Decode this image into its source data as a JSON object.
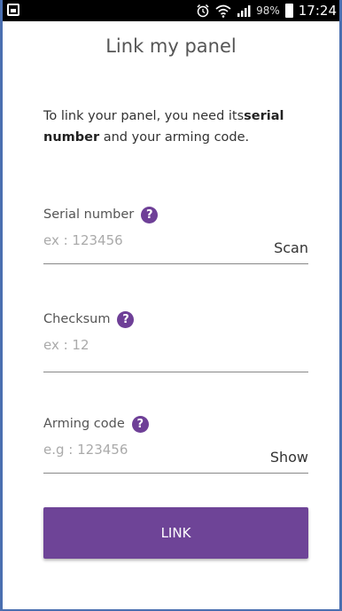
{
  "status_bar": {
    "battery_percent": "98%",
    "time": "17:24"
  },
  "page": {
    "title": "Link my panel",
    "intro_prefix": "To link your panel, you need its",
    "intro_bold": "serial number",
    "intro_suffix": " and your arming code."
  },
  "fields": {
    "serial": {
      "label": "Serial number",
      "placeholder": "ex : 123456",
      "value": "",
      "action": "Scan"
    },
    "checksum": {
      "label": "Checksum",
      "placeholder": "ex : 12",
      "value": ""
    },
    "arming": {
      "label": "Arming code",
      "placeholder": "e.g : 123456",
      "value": "",
      "action": "Show"
    }
  },
  "help_glyph": "?",
  "link_button": {
    "label": "LINK"
  },
  "colors": {
    "accent": "#6e4497",
    "frame": "#4a6fb0"
  },
  "icons": {
    "status_left": "gallery-icon",
    "alarm": "alarm-icon",
    "wifi": "wifi-icon",
    "signal": "signal-icon",
    "battery": "battery-icon",
    "help": "help-icon"
  }
}
